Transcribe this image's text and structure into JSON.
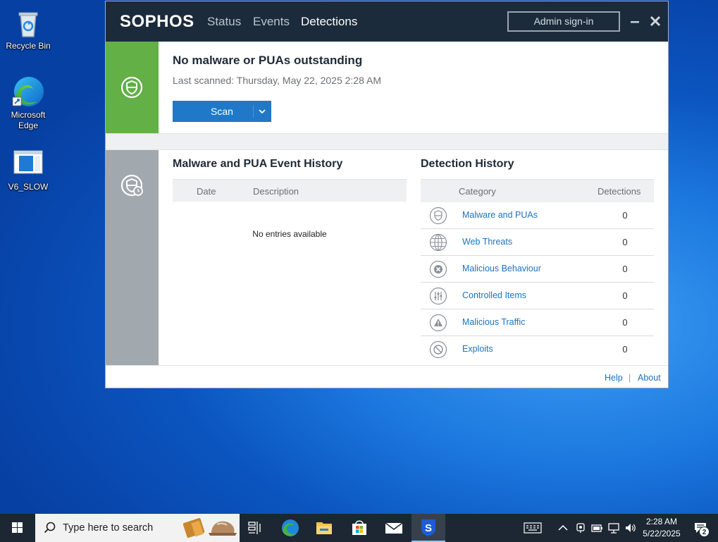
{
  "desktop": {
    "icons": [
      {
        "label": "Recycle Bin"
      },
      {
        "label": "Microsoft Edge"
      },
      {
        "label": "V6_SLOW"
      }
    ]
  },
  "app": {
    "logo": "SOPHOS",
    "nav": [
      "Status",
      "Events",
      "Detections"
    ],
    "active_nav": "Detections",
    "admin_signin": "Admin sign-in",
    "status": {
      "title": "No malware or PUAs outstanding",
      "last_scanned": "Last scanned: Thursday, May 22, 2025 2:28 AM",
      "scan_label": "Scan"
    },
    "event_history": {
      "title": "Malware and PUA Event History",
      "columns": [
        "Date",
        "Description"
      ],
      "empty_text": "No entries available"
    },
    "detection_history": {
      "title": "Detection History",
      "columns": [
        "Category",
        "Detections"
      ],
      "rows": [
        {
          "icon": "shield-icon",
          "category": "Malware and PUAs",
          "count": "0"
        },
        {
          "icon": "globe-icon",
          "category": "Web Threats",
          "count": "0"
        },
        {
          "icon": "x-circle-icon",
          "category": "Malicious Behaviour",
          "count": "0"
        },
        {
          "icon": "sliders-icon",
          "category": "Controlled Items",
          "count": "0"
        },
        {
          "icon": "warning-icon",
          "category": "Malicious Traffic",
          "count": "0"
        },
        {
          "icon": "blocked-icon",
          "category": "Exploits",
          "count": "0"
        }
      ]
    },
    "footer": {
      "help": "Help",
      "separator": "|",
      "about": "About"
    },
    "colors": {
      "titlebar": "#1b2b3b",
      "status_ok": "#62b046",
      "accent": "#2078c8",
      "link": "#1a73c4"
    }
  },
  "taskbar": {
    "search_placeholder": "Type here to search",
    "time": "2:28 AM",
    "date": "5/22/2025",
    "notification_count": "2"
  }
}
